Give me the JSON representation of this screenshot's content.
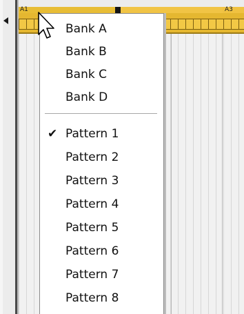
{
  "timeline": {
    "clips": [
      {
        "label": "A1"
      },
      {
        "label": "A3"
      }
    ]
  },
  "menu": {
    "banks": [
      "Bank A",
      "Bank B",
      "Bank C",
      "Bank D"
    ],
    "patterns": [
      "Pattern 1",
      "Pattern 2",
      "Pattern 3",
      "Pattern 4",
      "Pattern 5",
      "Pattern 6",
      "Pattern 7",
      "Pattern 8"
    ],
    "checked_pattern": "Pattern 1",
    "check_mark": "✔"
  },
  "colors": {
    "clip": "#e5b730",
    "menu_bg": "#ffffff",
    "grid_bg": "#f1f1f1"
  },
  "icons": {
    "cursor": "arrow-cursor-icon",
    "track_arrow": "triangle-left-icon",
    "check": "checkmark-icon"
  }
}
